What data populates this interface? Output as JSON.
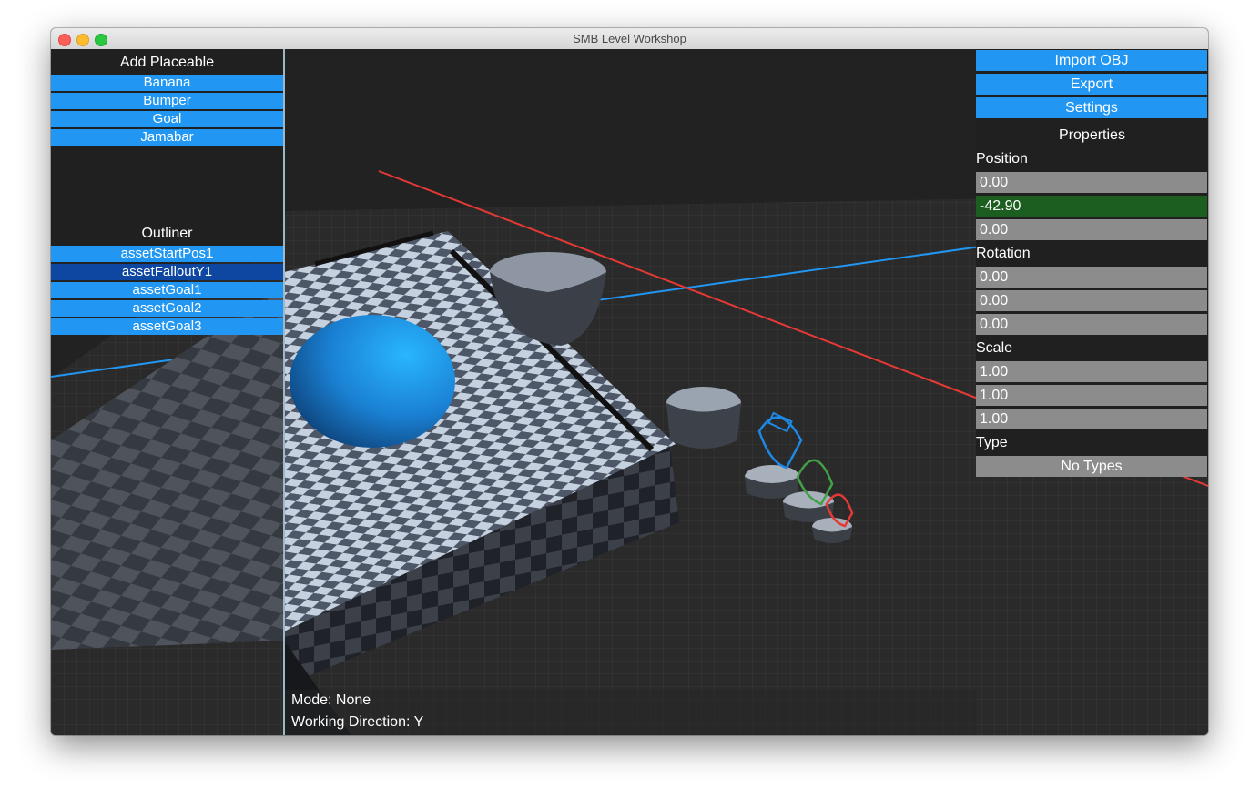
{
  "window": {
    "title": "SMB Level Workshop"
  },
  "add_placeable": {
    "title": "Add Placeable",
    "items": [
      "Banana",
      "Bumper",
      "Goal",
      "Jamabar"
    ]
  },
  "outliner": {
    "title": "Outliner",
    "items": [
      "assetStartPos1",
      "assetFalloutY1",
      "assetGoal1",
      "assetGoal2",
      "assetGoal3"
    ],
    "selected": "assetFalloutY1"
  },
  "toolbar": {
    "import_label": "Import OBJ",
    "export_label": "Export",
    "settings_label": "Settings"
  },
  "properties": {
    "title": "Properties",
    "position_label": "Position",
    "position": [
      "0.00",
      "-42.90",
      "0.00"
    ],
    "rotation_label": "Rotation",
    "rotation": [
      "0.00",
      "0.00",
      "0.00"
    ],
    "scale_label": "Scale",
    "scale": [
      "1.00",
      "1.00",
      "1.00"
    ],
    "type_label": "Type",
    "type_value": "No Types"
  },
  "status": {
    "mode": "Mode: None",
    "direction": "Working Direction: Y"
  },
  "colors": {
    "button_blue": "#2196f3",
    "selected_blue": "#0d47a1",
    "field_grey": "#8c8c8c",
    "active_field_green": "#1b5e20",
    "axis_red": "#e53935",
    "axis_blue": "#2196f3",
    "goal_blue": "#1e88e5",
    "goal_green": "#43a047",
    "goal_red": "#e53935"
  }
}
